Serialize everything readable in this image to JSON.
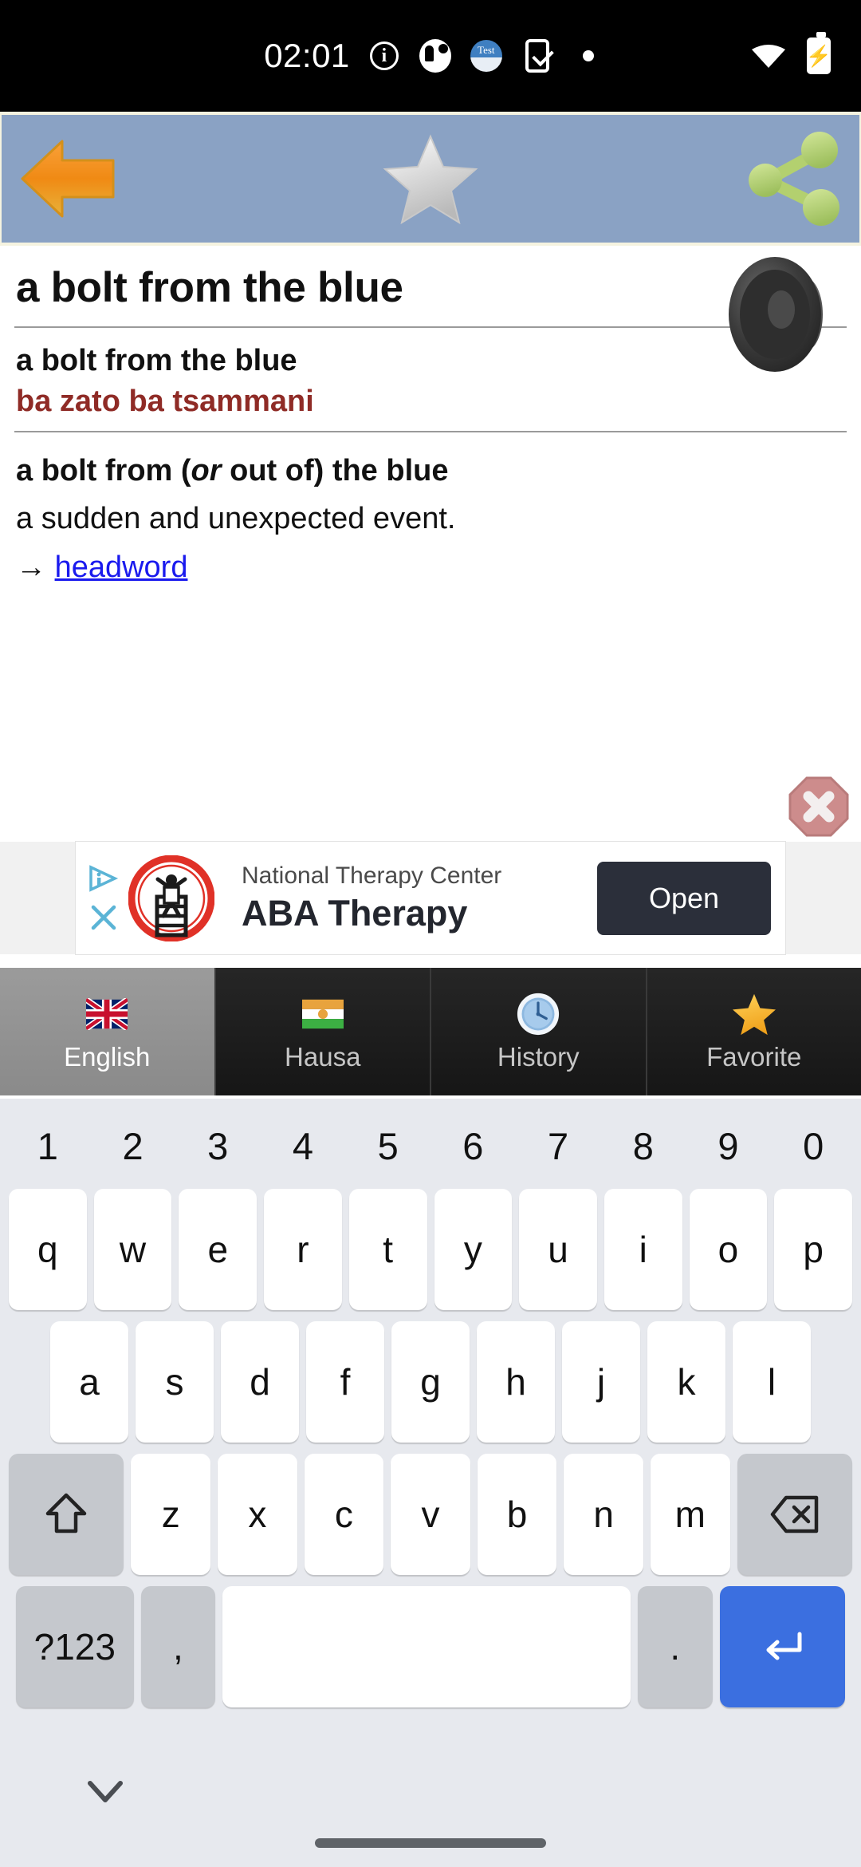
{
  "status_bar": {
    "time": "02:01",
    "icons": [
      "info-icon",
      "app-notification-icon",
      "test-app-icon",
      "phone-check-icon",
      "dot-icon"
    ],
    "right_icons": [
      "wifi-icon",
      "battery-charging-icon"
    ],
    "test_icon_label": "Test"
  },
  "toolbar": {
    "back_label": "Back",
    "favorite_label": "Favorite",
    "share_label": "Share",
    "background_color": "#8aa2c4"
  },
  "entry": {
    "title": "a bolt from the blue",
    "headword_en": "a bolt from the blue",
    "translation_ha": "ba zato ba tsammani",
    "translation_color": "#8f2b26",
    "definition_head_pre": "a bolt from (",
    "definition_head_em": "or",
    "definition_head_post": " out of) the blue",
    "definition_body": "a sudden and unexpected event.",
    "cross_ref_arrow": "→",
    "cross_ref_link": "headword",
    "speaker_label": "Pronounce"
  },
  "ad": {
    "close_label": "Close ad",
    "advertiser": "National Therapy Center",
    "headline": "ABA Therapy",
    "cta": "Open",
    "cta_color": "#2b2f3a",
    "adchoices_label": "AdChoices",
    "dismiss_label": "Dismiss"
  },
  "tabs": [
    {
      "label": "English",
      "icon": "uk-flag-icon",
      "active": true
    },
    {
      "label": "Hausa",
      "icon": "niger-flag-icon",
      "active": false
    },
    {
      "label": "History",
      "icon": "clock-icon",
      "active": false
    },
    {
      "label": "Favorite",
      "icon": "star-icon",
      "active": false
    }
  ],
  "keyboard": {
    "numbers": [
      "1",
      "2",
      "3",
      "4",
      "5",
      "6",
      "7",
      "8",
      "9",
      "0"
    ],
    "row1": [
      "q",
      "w",
      "e",
      "r",
      "t",
      "y",
      "u",
      "i",
      "o",
      "p"
    ],
    "row2": [
      "a",
      "s",
      "d",
      "f",
      "g",
      "h",
      "j",
      "k",
      "l"
    ],
    "row3_letters": [
      "z",
      "x",
      "c",
      "v",
      "b",
      "n",
      "m"
    ],
    "shift_label": "shift-icon",
    "backspace_label": "backspace-icon",
    "symbols_label": "?123",
    "comma_label": ",",
    "space_label": "",
    "period_label": ".",
    "enter_label": "enter-icon"
  },
  "navbar": {
    "hide_keyboard_label": "Hide keyboard",
    "home_indicator_label": "Home"
  }
}
